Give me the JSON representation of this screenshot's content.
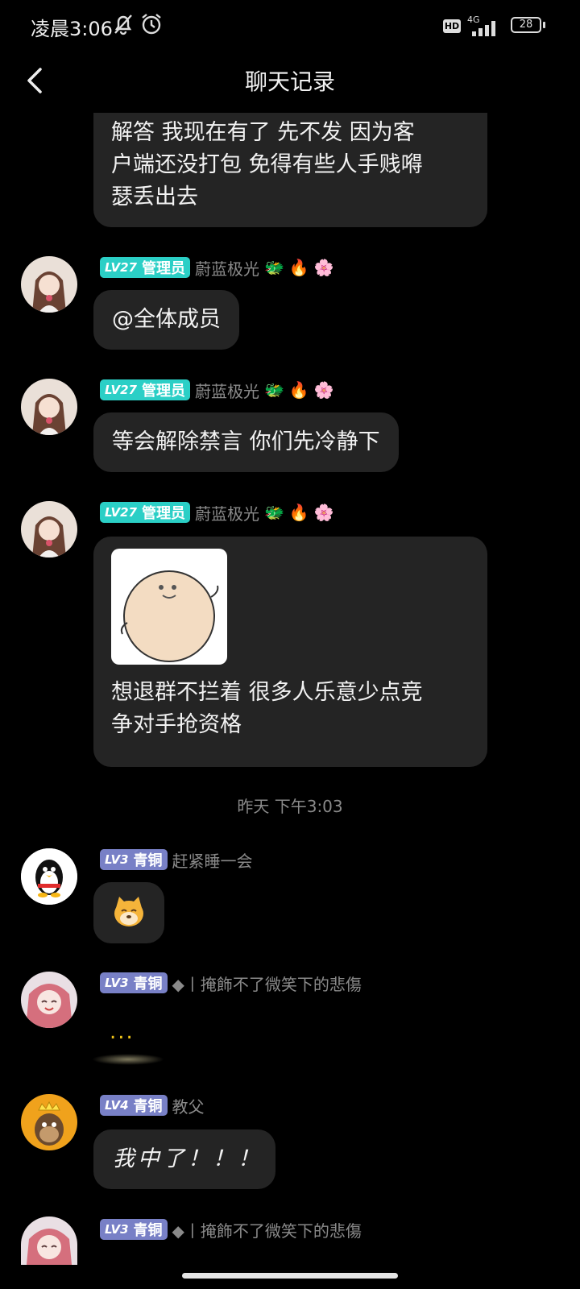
{
  "status": {
    "time": "凌晨3:06",
    "hd": "HD",
    "network": "4G",
    "battery": "28"
  },
  "header": {
    "title": "聊天记录"
  },
  "messages": {
    "m0": {
      "text_lines": [
        "解答 我现在有了 先不发 因为客",
        "户端还没打包  免得有些人手贱嘚",
        "瑟丢出去"
      ]
    },
    "m1": {
      "level": "LV27",
      "role": "管理员",
      "nick": "蔚蓝极光",
      "text": "@全体成员"
    },
    "m2": {
      "level": "LV27",
      "role": "管理员",
      "nick": "蔚蓝极光",
      "text": "等会解除禁言 你们先冷静下"
    },
    "m3": {
      "level": "LV27",
      "role": "管理员",
      "nick": "蔚蓝极光",
      "text_lines": [
        "想退群不拦着 很多人乐意少点竞",
        "争对手抢资格"
      ]
    },
    "m4": {
      "level": "LV3",
      "role": "青铜",
      "nick": "赶紧睡一会",
      "sticker_icon": "dog-face-sticker"
    },
    "m5": {
      "level": "LV3",
      "role": "青铜",
      "nick": "◆丨掩飾不了微笑下的悲傷",
      "text": "..."
    },
    "m6": {
      "level": "LV4",
      "role": "青铜",
      "nick": "教父",
      "text": "我中了！！！"
    },
    "m7": {
      "level": "LV3",
      "role": "青铜",
      "nick": "◆丨掩飾不了微笑下的悲傷"
    }
  },
  "timestamp": "昨天 下午3:03",
  "colors": {
    "admin_badge": "#2bcfc6",
    "bronze_badge": "#7880c6",
    "bubble": "#242424",
    "background": "#000000"
  }
}
